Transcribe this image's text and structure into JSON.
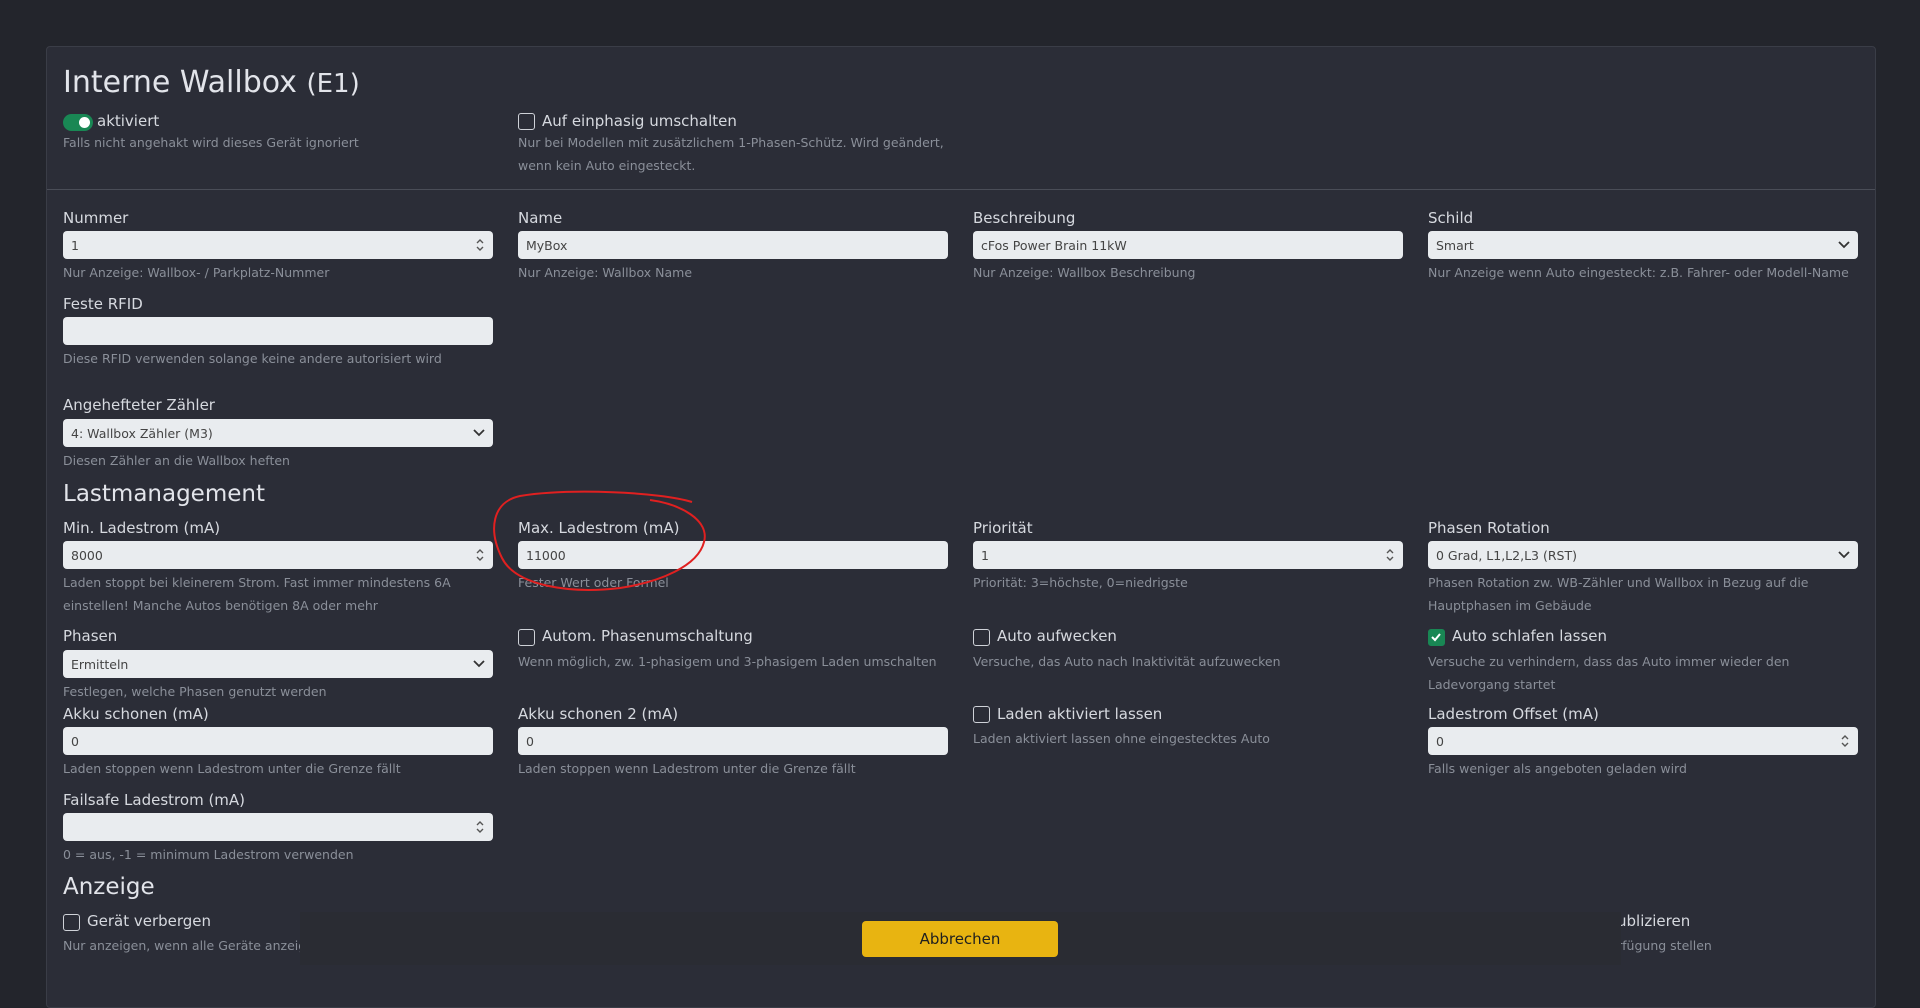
{
  "title": "Interne Wallbox",
  "title_suffix": "(E1)",
  "active": {
    "label": "aktiviert",
    "help": "Falls nicht angehakt wird dieses Gerät ignoriert"
  },
  "single_phase": {
    "label": "Auf einphasig umschalten",
    "help": "Nur bei Modellen mit zusätzlichem 1-Phasen-Schütz. Wird geändert, wenn kein Auto eingesteckt."
  },
  "number": {
    "label": "Nummer",
    "value": "1",
    "help": "Nur Anzeige: Wallbox- / Parkplatz-Nummer"
  },
  "name": {
    "label": "Name",
    "value": "MyBox",
    "help": "Nur Anzeige: Wallbox Name"
  },
  "description": {
    "label": "Beschreibung",
    "value": "cFos Power Brain 11kW",
    "help": "Nur Anzeige: Wallbox Beschreibung"
  },
  "sign": {
    "label": "Schild",
    "value": "Smart",
    "help": "Nur Anzeige wenn Auto eingesteckt: z.B. Fahrer- oder Modell-Name"
  },
  "rfid": {
    "label": "Feste RFID",
    "value": "",
    "help": "Diese RFID verwenden solange keine andere autorisiert wird"
  },
  "meter": {
    "label": "Angehefteter Zähler",
    "value": "4: Wallbox Zähler (M3)",
    "help": "Diesen Zähler an die Wallbox heften"
  },
  "load_mgmt": "Lastmanagement",
  "min_current": {
    "label": "Min. Ladestrom (mA)",
    "value": "8000",
    "help": "Laden stoppt bei kleinerem Strom. Fast immer mindestens 6A einstellen! Manche Autos benötigen 8A oder mehr"
  },
  "max_current": {
    "label": "Max. Ladestrom (mA)",
    "value": "11000",
    "help": "Fester Wert oder Formel"
  },
  "priority": {
    "label": "Priorität",
    "value": "1",
    "help": "Priorität: 3=höchste, 0=niedrigste"
  },
  "phase_rotation": {
    "label": "Phasen Rotation",
    "value": "0 Grad, L1,L2,L3 (RST)",
    "help": "Phasen Rotation zw. WB-Zähler und Wallbox in Bezug auf die Hauptphasen im Gebäude"
  },
  "phases": {
    "label": "Phasen",
    "value": "Ermitteln",
    "help": "Festlegen, welche Phasen genutzt werden"
  },
  "auto_phase": {
    "label": "Autom. Phasenumschaltung",
    "help": "Wenn möglich, zw. 1-phasigem und 3-phasigem Laden umschalten"
  },
  "wake_car": {
    "label": "Auto aufwecken",
    "help": "Versuche, das Auto nach Inaktivität aufzuwecken"
  },
  "sleep_car": {
    "label": "Auto schlafen lassen",
    "help": "Versuche zu verhindern, dass das Auto immer wieder den Ladevorgang startet"
  },
  "battery_save": {
    "label": "Akku schonen (mA)",
    "value": "0",
    "help": "Laden stoppen wenn Ladestrom unter die Grenze fällt"
  },
  "battery_save2": {
    "label": "Akku schonen 2 (mA)",
    "value": "0",
    "help": "Laden stoppen wenn Ladestrom unter die Grenze fällt"
  },
  "keep_charging": {
    "label": "Laden aktiviert lassen",
    "help": "Laden aktiviert lassen ohne eingestecktes Auto"
  },
  "current_offset": {
    "label": "Ladestrom Offset (mA)",
    "value": "0",
    "help": "Falls weniger als angeboten geladen wird"
  },
  "failsafe": {
    "label": "Failsafe Ladestrom (mA)",
    "value": "",
    "help": "0 = aus, -1 = minimum Ladestrom verwenden"
  },
  "display": "Anzeige",
  "hide_device": {
    "label": "Gerät verbergen",
    "help": "Nur anzeigen, wenn alle Geräte anzeigen"
  },
  "publish_partial": {
    "label": "ublizieren",
    "help": "rfügung stellen"
  },
  "cancel_button": "Abbrechen",
  "colors": {
    "accent_green": "#198754",
    "button_yellow": "#e8b411",
    "annotation_red": "#e02020"
  }
}
